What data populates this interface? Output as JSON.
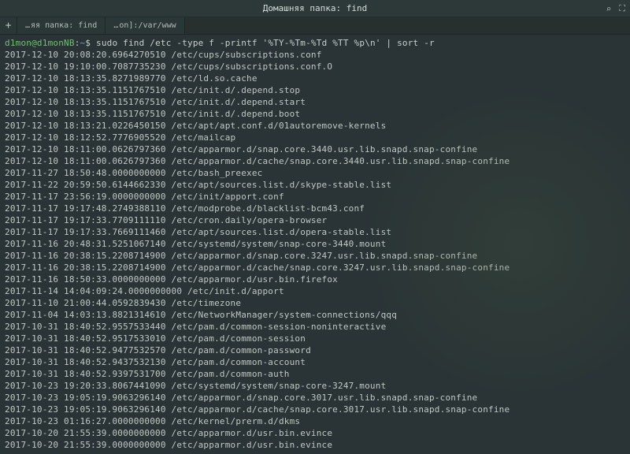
{
  "window": {
    "title": "Домашняя папка: find"
  },
  "controls": {
    "search_icon": "⌕",
    "fullscreen_icon": "⛶"
  },
  "tabs": [
    {
      "id": "new",
      "label": "+"
    },
    {
      "id": "t1",
      "label_prefix": "…",
      "label_rest": "яя папка: find"
    },
    {
      "id": "t2",
      "label_prefix": "…",
      "label_rest": "on]:/var/www"
    }
  ],
  "prompt": {
    "userhost": "d1mon@d1monNB",
    "sep": ":",
    "tilde": "~",
    "dollar": "$ "
  },
  "command": "sudo find /etc -type f -printf '%TY-%Tm-%Td %TT %p\\n' | sort -r",
  "output": [
    "2017-12-10 20:08:20.6964270510 /etc/cups/subscriptions.conf",
    "2017-12-10 19:10:00.7087735230 /etc/cups/subscriptions.conf.O",
    "2017-12-10 18:13:35.8271989770 /etc/ld.so.cache",
    "2017-12-10 18:13:35.1151767510 /etc/init.d/.depend.stop",
    "2017-12-10 18:13:35.1151767510 /etc/init.d/.depend.start",
    "2017-12-10 18:13:35.1151767510 /etc/init.d/.depend.boot",
    "2017-12-10 18:13:21.0226450150 /etc/apt/apt.conf.d/01autoremove-kernels",
    "2017-12-10 18:12:52.7776905520 /etc/mailcap",
    "2017-12-10 18:11:00.0626797360 /etc/apparmor.d/snap.core.3440.usr.lib.snapd.snap-confine",
    "2017-12-10 18:11:00.0626797360 /etc/apparmor.d/cache/snap.core.3440.usr.lib.snapd.snap-confine",
    "2017-11-27 18:50:48.0000000000 /etc/bash_preexec",
    "2017-11-22 20:59:50.6144662330 /etc/apt/sources.list.d/skype-stable.list",
    "2017-11-17 23:56:19.0000000000 /etc/init/apport.conf",
    "2017-11-17 19:17:48.2749388110 /etc/modprobe.d/blacklist-bcm43.conf",
    "2017-11-17 19:17:33.7709111110 /etc/cron.daily/opera-browser",
    "2017-11-17 19:17:33.7669111460 /etc/apt/sources.list.d/opera-stable.list",
    "2017-11-16 20:48:31.5251067140 /etc/systemd/system/snap-core-3440.mount",
    "2017-11-16 20:38:15.2208714900 /etc/apparmor.d/snap.core.3247.usr.lib.snapd.snap-confine",
    "2017-11-16 20:38:15.2208714900 /etc/apparmor.d/cache/snap.core.3247.usr.lib.snapd.snap-confine",
    "2017-11-16 18:50:33.0000000000 /etc/apparmor.d/usr.bin.firefox",
    "2017-11-14 14:04:09:24.0000000000 /etc/init.d/apport",
    "2017-11-10 21:00:44.0592839430 /etc/timezone",
    "2017-11-04 14:03:13.8821314610 /etc/NetworkManager/system-connections/qqq",
    "2017-10-31 18:40:52.9557533440 /etc/pam.d/common-session-noninteractive",
    "2017-10-31 18:40:52.9517533010 /etc/pam.d/common-session",
    "2017-10-31 18:40:52.9477532570 /etc/pam.d/common-password",
    "2017-10-31 18:40:52.9437532130 /etc/pam.d/common-account",
    "2017-10-31 18:40:52.9397531700 /etc/pam.d/common-auth",
    "2017-10-23 19:20:33.8067441090 /etc/systemd/system/snap-core-3247.mount",
    "2017-10-23 19:05:19.9063296140 /etc/apparmor.d/snap.core.3017.usr.lib.snapd.snap-confine",
    "2017-10-23 19:05:19.9063296140 /etc/apparmor.d/cache/snap.core.3017.usr.lib.snapd.snap-confine",
    "2017-10-23 01:16:27.0000000000 /etc/kernel/prerm.d/dkms",
    "2017-10-20 21:55:39.0000000000 /etc/apparmor.d/usr.bin.evince",
    "2017-10-20 21:55:39.0000000000 /etc/apparmor.d/usr.bin.evince"
  ]
}
